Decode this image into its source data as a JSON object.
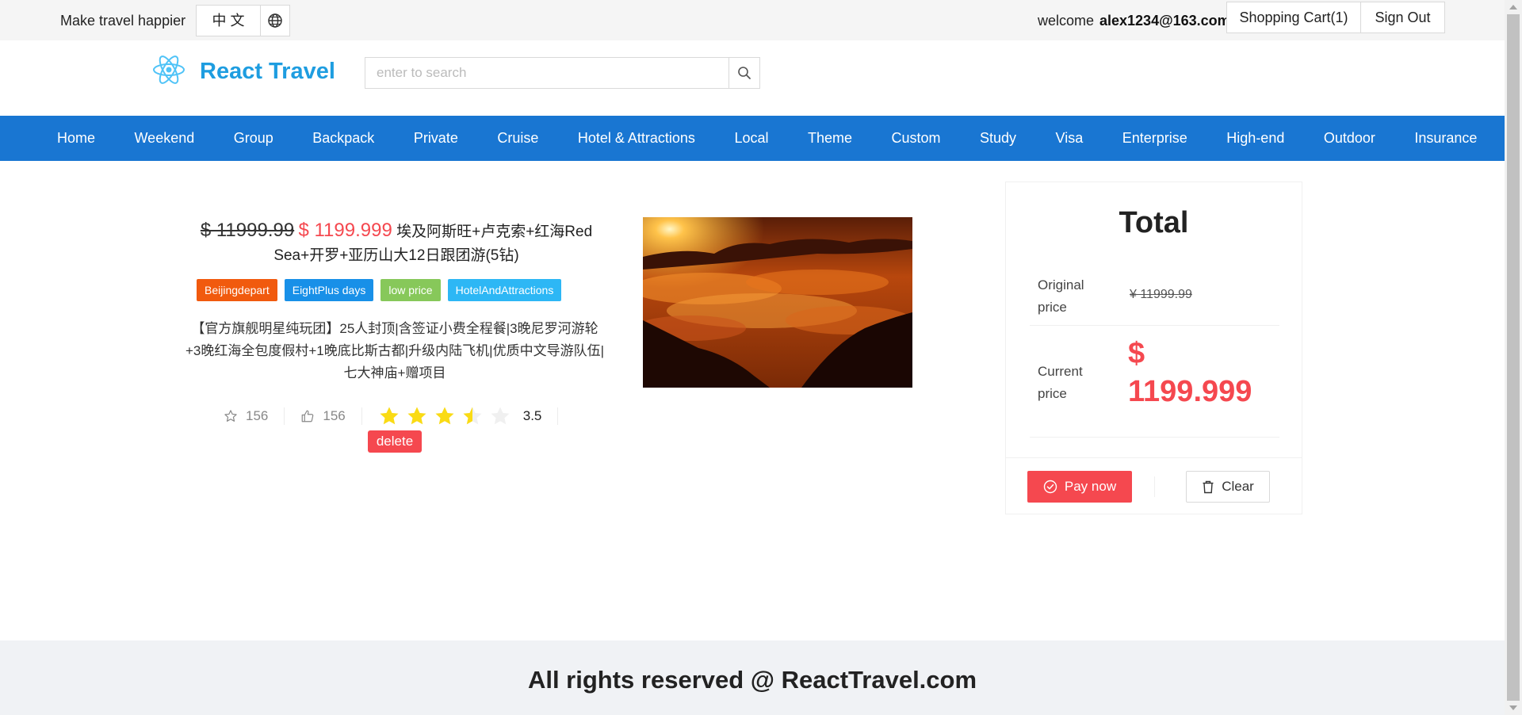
{
  "topbar": {
    "tagline": "Make travel happier",
    "language": "中 文",
    "welcome": "welcome",
    "username": "alex1234@163.com",
    "cart": "Shopping Cart(1)",
    "signout": "Sign Out"
  },
  "header": {
    "logo_text": "React Travel",
    "search_placeholder": "enter to search"
  },
  "nav": [
    "Home",
    "Weekend",
    "Group",
    "Backpack",
    "Private",
    "Cruise",
    "Hotel & Attractions",
    "Local",
    "Theme",
    "Custom",
    "Study",
    "Visa",
    "Enterprise",
    "High-end",
    "Outdoor",
    "Insurance"
  ],
  "product": {
    "original_price": "$ 11999.99",
    "current_price": "$ 1199.999",
    "title": "埃及阿斯旺+卢克索+红海Red Sea+开罗+亚历山大12日跟团游(5钻)",
    "tags": [
      {
        "label": "Beijingdepart",
        "color": "#f15a0e"
      },
      {
        "label": "EightPlus days",
        "color": "#1890e8"
      },
      {
        "label": "low price",
        "color": "#87c85a"
      },
      {
        "label": "HotelAndAttractions",
        "color": "#2db7f5"
      }
    ],
    "description": "【官方旗舰明星纯玩团】25人封顶|含签证小费全程餐|3晚尼罗河游轮+3晚红海全包度假村+1晚底比斯古都|升级内陆飞机|优质中文导游队伍|七大神庙+赠项目",
    "favorites": "156",
    "likes": "156",
    "rating": 3.5,
    "rating_text": "3.5",
    "delete_label": "delete",
    "star_color": "#fadb14"
  },
  "total": {
    "title": "Total",
    "original_label": "Original price",
    "original_value": "¥ 11999.99",
    "current_label": "Current price",
    "current_value": "$ 1199.999",
    "pay_label": "Pay now",
    "clear_label": "Clear"
  },
  "footer": {
    "text": "All rights reserved @ ReactTravel.com"
  },
  "colors": {
    "brand": "#1976d2",
    "accent": "#f5484f",
    "logo": "#1e9de0"
  }
}
